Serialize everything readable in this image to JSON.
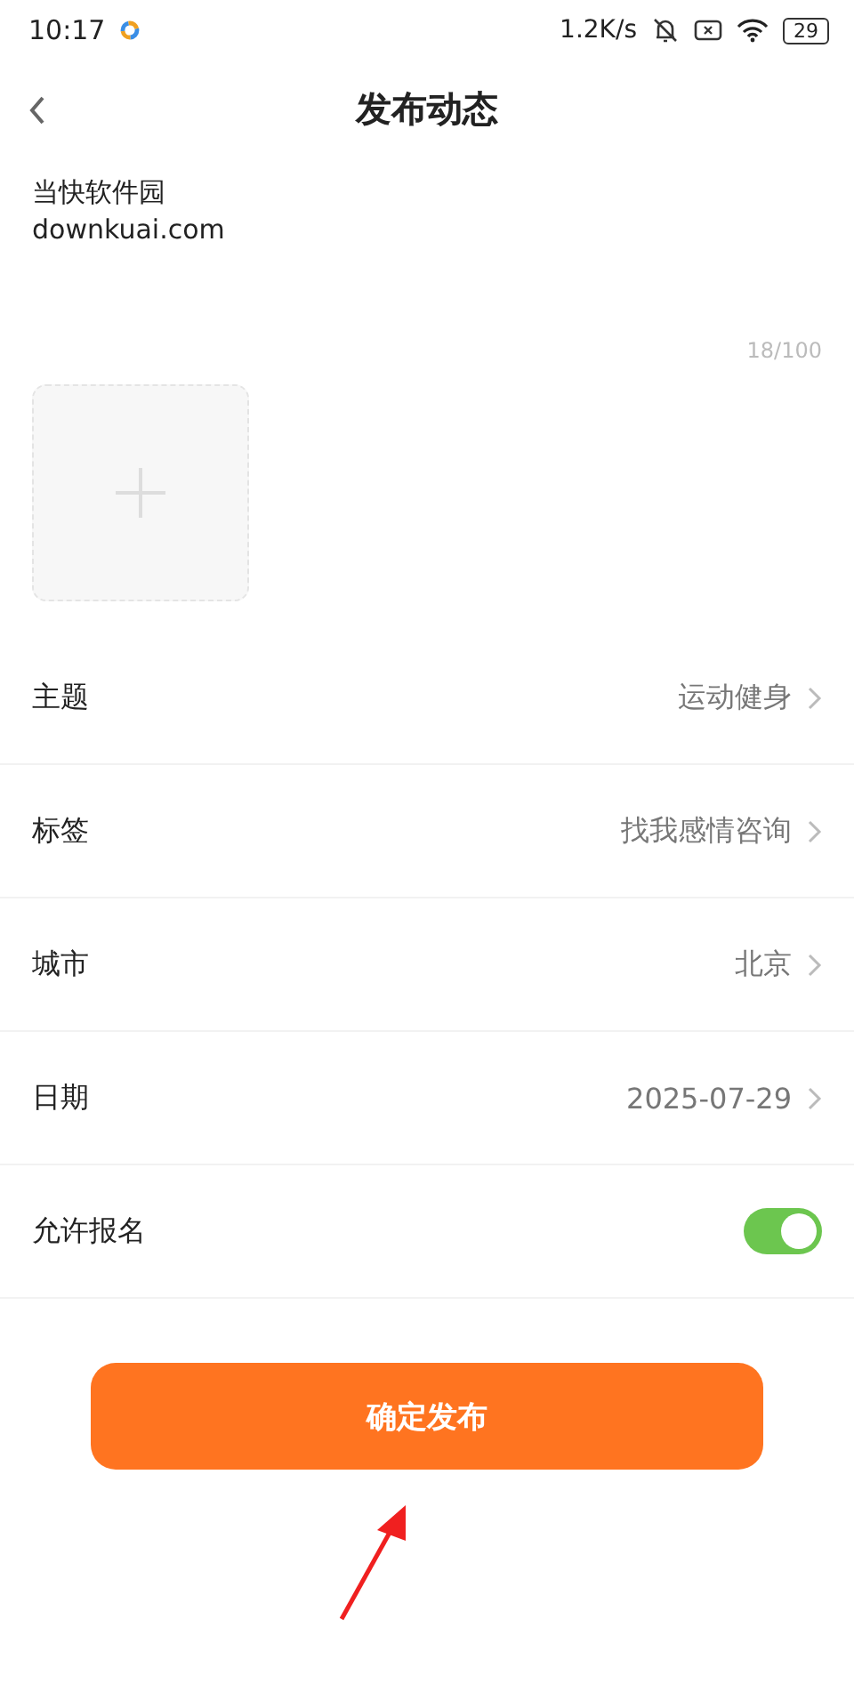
{
  "status_bar": {
    "time": "10:17",
    "speed": "1.2K/s",
    "battery": "29"
  },
  "header": {
    "title": "发布动态"
  },
  "post": {
    "lines": [
      "当快软件园",
      "downkuai.com"
    ],
    "counter": "18/100"
  },
  "rows": [
    {
      "kind": "select",
      "label": "主题",
      "value": "运动健身"
    },
    {
      "kind": "select",
      "label": "标签",
      "value": "找我感情咨询"
    },
    {
      "kind": "select",
      "label": "城市",
      "value": "北京"
    },
    {
      "kind": "select",
      "label": "日期",
      "value": "2025-07-29"
    },
    {
      "kind": "toggle",
      "label": "允许报名",
      "on": true
    }
  ],
  "submit": {
    "label": "确定发布"
  }
}
